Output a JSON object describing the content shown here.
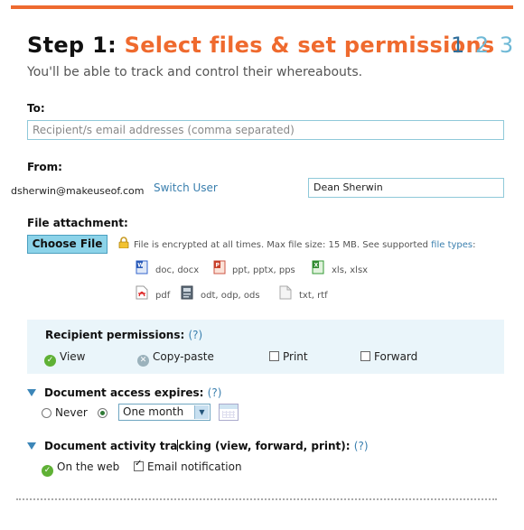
{
  "header": {
    "step_prefix": "Step 1:",
    "step_title": "Select files & set permissions",
    "steps": [
      "1",
      "2",
      "3"
    ],
    "subtitle": "You'll be able to track and control their whereabouts."
  },
  "to": {
    "label": "To:",
    "placeholder": "Recipient/s email addresses (comma separated)"
  },
  "from": {
    "label": "From:",
    "email": "dsherwin@makeuseof.com",
    "switch_user": "Switch User",
    "name_value": "Dean Sherwin"
  },
  "attachment": {
    "label": "File attachment:",
    "button": "Choose File",
    "note": "File is encrypted at all times. Max file size: 15 MB. See supported",
    "file_types_link": "file types",
    "note_suffix": ":",
    "types": [
      {
        "icon": "word-doc-icon",
        "label": "doc, docx"
      },
      {
        "icon": "powerpoint-icon",
        "label": "ppt, pptx, pps"
      },
      {
        "icon": "excel-icon",
        "label": "xls, xlsx"
      },
      {
        "icon": "pdf-icon",
        "label": "pdf"
      },
      {
        "icon": "open-document-icon",
        "label": "odt, odp, ods"
      },
      {
        "icon": "text-file-icon",
        "label": "txt, rtf"
      }
    ]
  },
  "permissions": {
    "title": "Recipient permissions:",
    "help": "(?)",
    "items": [
      {
        "label": "View",
        "state": "allowed"
      },
      {
        "label": "Copy-paste",
        "state": "blocked"
      },
      {
        "label": "Print",
        "state": "unchecked"
      },
      {
        "label": "Forward",
        "state": "unchecked"
      }
    ]
  },
  "expiry": {
    "title": "Document access expires:",
    "help": "(?)",
    "never_label": "Never",
    "selected_option": "One month"
  },
  "tracking": {
    "title_before_cursor": "Document activity tra",
    "title_after_cursor": "cking (view, forward, print):",
    "help": "(?)",
    "on_web": "On the web",
    "email_notification": "Email notification"
  },
  "colors": {
    "accent": "#ef6a2e",
    "step_active": "#2f6e9b",
    "step_inactive": "#6fb9d6",
    "link": "#3a7fae",
    "button": "#8cd3e9"
  }
}
